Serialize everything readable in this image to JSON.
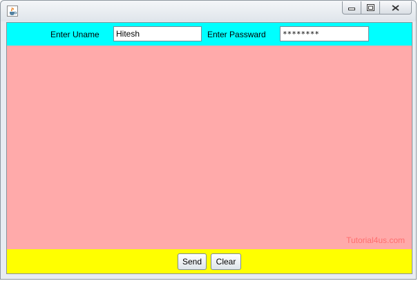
{
  "window": {
    "icon": "java-cup-icon",
    "controls": [
      "minimize-icon",
      "restore-icon",
      "close-icon"
    ]
  },
  "form": {
    "uname_label": "Enter Uname",
    "uname_value": "Hitesh",
    "password_label": "Enter Passward",
    "password_value": "********"
  },
  "watermark": "Tutorial4us.com",
  "buttons": {
    "send": "Send",
    "clear": "Clear"
  },
  "colors": {
    "top_panel": "#00ffff",
    "center_panel": "#ffaaaa",
    "bottom_panel": "#ffff00",
    "watermark": "#ff6d6d"
  }
}
